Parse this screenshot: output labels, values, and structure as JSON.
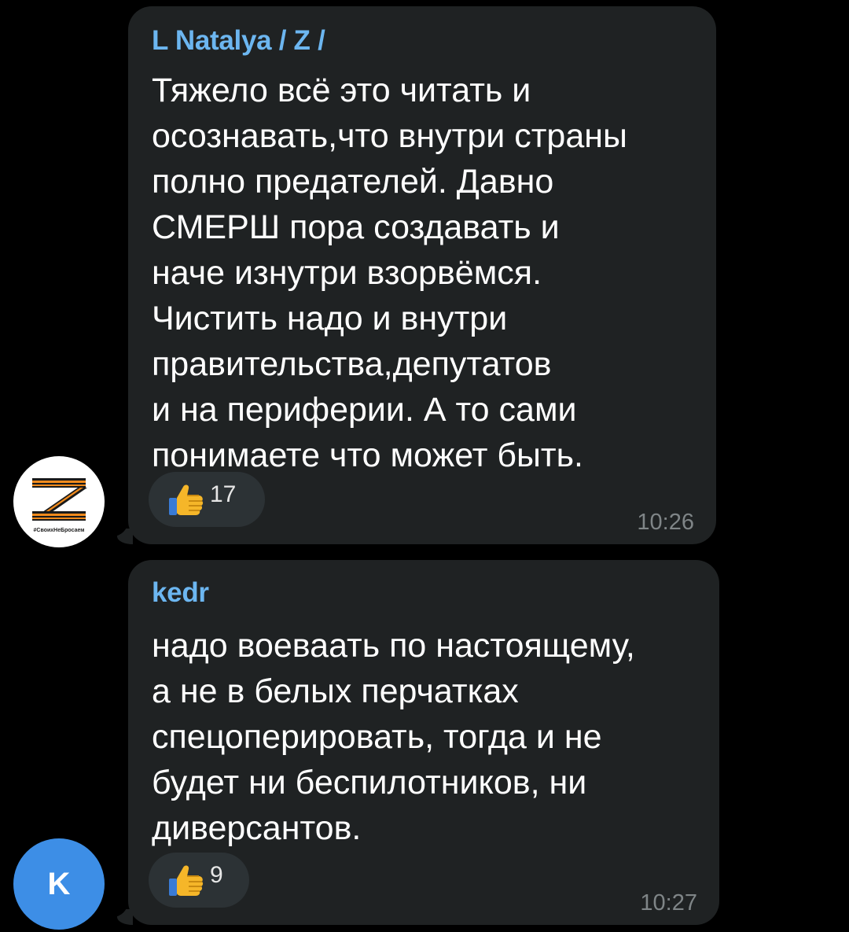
{
  "messages": [
    {
      "sender": "L Natalya / Z /",
      "text": "Тяжело всё это читать и\nосознавать,что внутри страны\nполно предателей. Давно\nСМЕРШ пора создавать и\nначе изнутри взорвёмся.\nЧистить надо и внутри\nправительства,депутатов\nи на периферии. А то  сами\nпонимаете что может быть.",
      "reaction": {
        "icon": "thumbs-up-icon",
        "count": "17"
      },
      "time": "10:26",
      "avatar": {
        "type": "z-ribbon",
        "caption": "#СвоихНеБросаем"
      }
    },
    {
      "sender": "kedr",
      "text": "надо воеваать по настоящему,\nа не в белых перчатках\nспецоперировать, тогда и не\nбудет ни беспилотников, ни\nдиверсантов.",
      "reaction": {
        "icon": "thumbs-up-icon",
        "count": "9"
      },
      "time": "10:27",
      "avatar": {
        "type": "initial",
        "letter": "K",
        "color": "#3d8ee6"
      }
    }
  ],
  "colors": {
    "background": "#000000",
    "bubble": "#1f2223",
    "sender_name": "#6cb6f0",
    "reaction_bg": "#2c3235",
    "time": "#7f8587"
  }
}
